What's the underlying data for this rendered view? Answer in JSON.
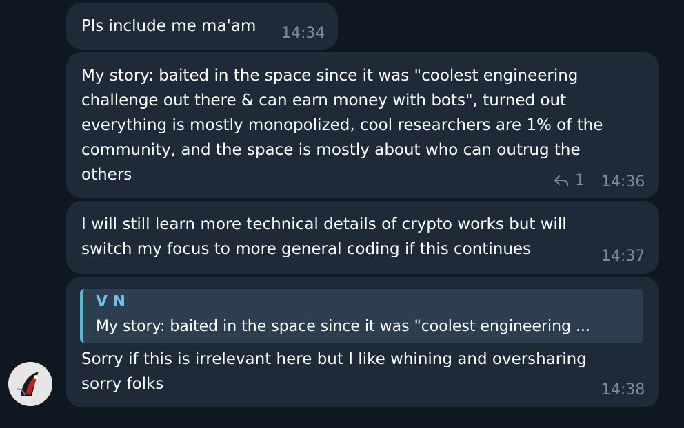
{
  "messages": [
    {
      "text": "Pls include me ma'am",
      "time": "14:34"
    },
    {
      "text": "My story: baited in the space since it was \"coolest engineering\nchallenge out there & can earn money with bots\", turned out\neverything is mostly monopolized, cool researchers are 1% of the\ncommunity, and the space is mostly about who can outrug the\nothers",
      "time": "14:36",
      "reply_count": "1"
    },
    {
      "text": "I will still learn more technical details of crypto works but will\nswitch my focus to more general coding if this continues",
      "time": "14:37"
    },
    {
      "quote_name": "V N",
      "quote_text": "My story: baited in the space since it was \"coolest engineering ...",
      "text": "Sorry if this is irrelevant here but I like whining and oversharing\nsorry folks",
      "time": "14:38"
    }
  ],
  "colors": {
    "background": "#0f1721",
    "bubble": "#1e2a38",
    "quote_accent": "#5fb4d6",
    "timestamp": "#7f8b98"
  },
  "icons": {
    "reply": "reply-arrow-icon"
  }
}
